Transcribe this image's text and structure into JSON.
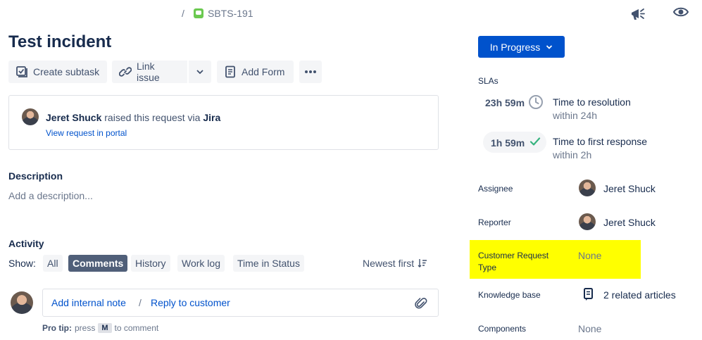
{
  "breadcrumb": {
    "separator": "/",
    "issue_key": "SBTS-191"
  },
  "issue": {
    "title": "Test incident"
  },
  "toolbar": {
    "create_subtask": "Create subtask",
    "link_issue": "Link issue",
    "add_form": "Add Form"
  },
  "request": {
    "reporter_name": "Jeret Shuck",
    "raised_text": " raised this request via ",
    "channel": "Jira",
    "view_link": "View request in portal"
  },
  "description": {
    "heading": "Description",
    "placeholder": "Add a description..."
  },
  "activity": {
    "heading": "Activity",
    "show_label": "Show:",
    "filters": [
      "All",
      "Comments",
      "History",
      "Work log",
      "Time in Status"
    ],
    "active_filter": "Comments",
    "sort_label": "Newest first",
    "add_internal_note": "Add internal note",
    "separator": "/",
    "reply_to_customer": "Reply to customer",
    "pro_tip_bold": "Pro tip:",
    "pro_tip_press": "press",
    "pro_tip_key": "M",
    "pro_tip_suffix": "to comment"
  },
  "sidebar": {
    "status": "In Progress",
    "slas_label": "SLAs",
    "slas": [
      {
        "time": "23h 59m",
        "title": "Time to resolution",
        "subtitle": "within 24h",
        "icon": "clock-icon"
      },
      {
        "time": "1h 59m",
        "title": "Time to first response",
        "subtitle": "within 2h",
        "icon": "check-icon"
      }
    ],
    "fields": {
      "assignee": {
        "label": "Assignee",
        "value": "Jeret Shuck"
      },
      "reporter": {
        "label": "Reporter",
        "value": "Jeret Shuck"
      },
      "customer_request_type": {
        "label_line1": "Customer Request",
        "label_line2": "Type",
        "value": "None"
      },
      "knowledge_base": {
        "label": "Knowledge base",
        "value": "2 related articles"
      },
      "components": {
        "label": "Components",
        "value": "None"
      }
    }
  },
  "colors": {
    "primary": "#0052cc",
    "highlight": "#ffff00",
    "success": "#36b37e",
    "issue_type": "#6bc950"
  }
}
